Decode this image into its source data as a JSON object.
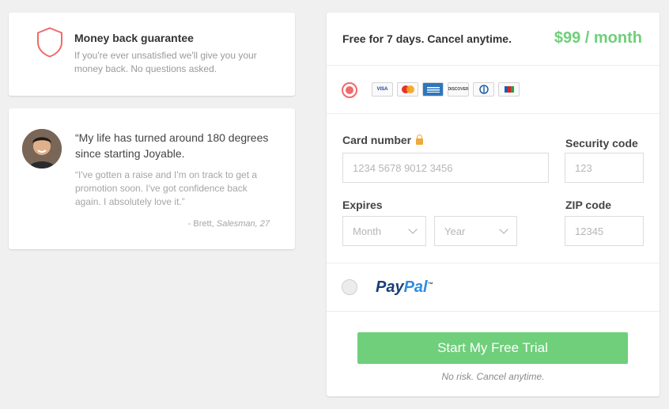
{
  "guarantee": {
    "title": "Money back guarantee",
    "description": "If you're ever unsatisfied we'll give you your money back. No questions asked.",
    "icon": "shield-icon"
  },
  "testimonial": {
    "quote": "“My life has turned around 180 degrees since starting Joyable.",
    "detail": "“I've gotten a raise and I'm on track to get a promotion soon. I've got confidence back again. I absolutely love it.”",
    "author_prefix": "- Brett, ",
    "author_role": "Salesman, 27"
  },
  "plan": {
    "summary": "Free for 7 days. Cancel anytime.",
    "price": "$99 / month"
  },
  "payment": {
    "card_selected": true,
    "card_brands": [
      "VISA",
      "MC",
      "AMEX",
      "DISCOVER",
      "DINERS",
      "JCB"
    ],
    "card_number": {
      "label": "Card number",
      "placeholder": "1234 5678 9012 3456"
    },
    "security_code": {
      "label": "Security code",
      "placeholder": "123"
    },
    "expires": {
      "label": "Expires",
      "month": "Month",
      "year": "Year"
    },
    "zip": {
      "label": "ZIP code",
      "placeholder": "12345"
    },
    "paypal": {
      "pay": "Pay",
      "pal": "Pal",
      "tm": "™"
    }
  },
  "cta": {
    "label": "Start My Free Trial",
    "note": "No risk. Cancel anytime."
  },
  "colors": {
    "accent_green": "#6fcf7b",
    "radio_red": "#f06a6a",
    "lock_orange": "#f0a93b"
  }
}
